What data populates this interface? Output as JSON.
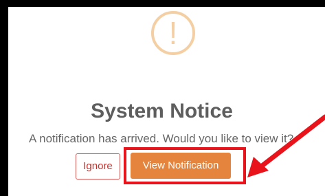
{
  "dialog": {
    "icon": "exclamation-circle-icon",
    "icon_glyph": "!",
    "title": "System Notice",
    "message": "A notification has arrived. Would you like to view it?",
    "buttons": {
      "ignore_label": "Ignore",
      "view_label": "View Notification"
    }
  },
  "colors": {
    "icon": "#f5cfa4",
    "title_text": "#5e5e5e",
    "ignore_text": "#c9302c",
    "view_bg": "#e5843d",
    "annotation": "#e8131b",
    "frame": "#000000"
  }
}
